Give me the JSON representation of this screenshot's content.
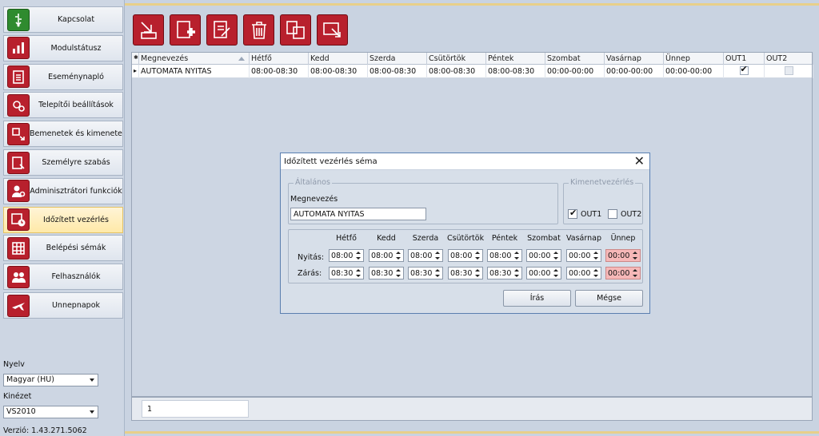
{
  "sidebar": {
    "items": [
      {
        "label": "Kapcsolat",
        "icon": "usb-icon"
      },
      {
        "label": "Modulstátusz",
        "icon": "bar-chart-icon"
      },
      {
        "label": "Eseménynapló",
        "icon": "clipboard-icon"
      },
      {
        "label": "Telepítői beállítások",
        "icon": "gears-icon"
      },
      {
        "label": "Bemenetek és kimenetek",
        "icon": "io-arrows-icon"
      },
      {
        "label": "Személyre szabás",
        "icon": "customize-icon"
      },
      {
        "label": "Adminisztrátori funkciók",
        "icon": "admin-user-icon"
      },
      {
        "label": "Időzített vezérlés",
        "icon": "calendar-clock-icon"
      },
      {
        "label": "Belépési sémák",
        "icon": "access-scheme-icon"
      },
      {
        "label": "Felhasználók",
        "icon": "users-icon"
      },
      {
        "label": "Ünnepnapok",
        "icon": "holiday-plane-icon"
      }
    ],
    "active_index": 7,
    "language_label": "Nyelv",
    "language_value": "Magyar (HU)",
    "theme_label": "Kinézet",
    "theme_value": "VS2010",
    "version": "Verzió: 1.43.271.5062"
  },
  "toolbar": {
    "buttons": [
      "import-icon",
      "add-icon",
      "edit-icon",
      "delete-icon",
      "copy-icon",
      "export-icon"
    ]
  },
  "grid": {
    "columns": [
      "Megnevezés",
      "Hétfő",
      "Kedd",
      "Szerda",
      "Csütörtök",
      "Péntek",
      "Szombat",
      "Vasárnap",
      "Ünnep",
      "OUT1",
      "OUT2"
    ],
    "rows": [
      {
        "name": "AUTOMATA NYITAS",
        "cells": [
          "08:00-08:30",
          "08:00-08:30",
          "08:00-08:30",
          "08:00-08:30",
          "08:00-08:30",
          "00:00-00:00",
          "00:00-00:00",
          "00:00-00:00"
        ],
        "out1": true,
        "out2": false
      }
    ]
  },
  "pager": {
    "page": "1"
  },
  "dialog": {
    "title": "Időzített vezérlés séma",
    "general_group": "Általános",
    "name_label": "Megnevezés",
    "name_value": "AUTOMATA NYITAS",
    "output_group": "Kimenetvezérlés",
    "out1_label": "OUT1",
    "out1_checked": true,
    "out2_label": "OUT2",
    "out2_checked": false,
    "days": [
      "Hétfő",
      "Kedd",
      "Szerda",
      "Csütörtök",
      "Péntek",
      "Szombat",
      "Vasárnap",
      "Ünnep"
    ],
    "open_label": "Nyitás:",
    "close_label": "Zárás:",
    "open_times": [
      "08:00",
      "08:00",
      "08:00",
      "08:00",
      "08:00",
      "00:00",
      "00:00",
      "00:00"
    ],
    "close_times": [
      "08:30",
      "08:30",
      "08:30",
      "08:30",
      "08:30",
      "00:00",
      "00:00",
      "00:00"
    ],
    "write_button": "Írás",
    "cancel_button": "Mégse"
  },
  "colors": {
    "accent_red": "#b8202d",
    "active_nav": "#ffe9a8",
    "holiday_field": "#f6b8b8"
  }
}
